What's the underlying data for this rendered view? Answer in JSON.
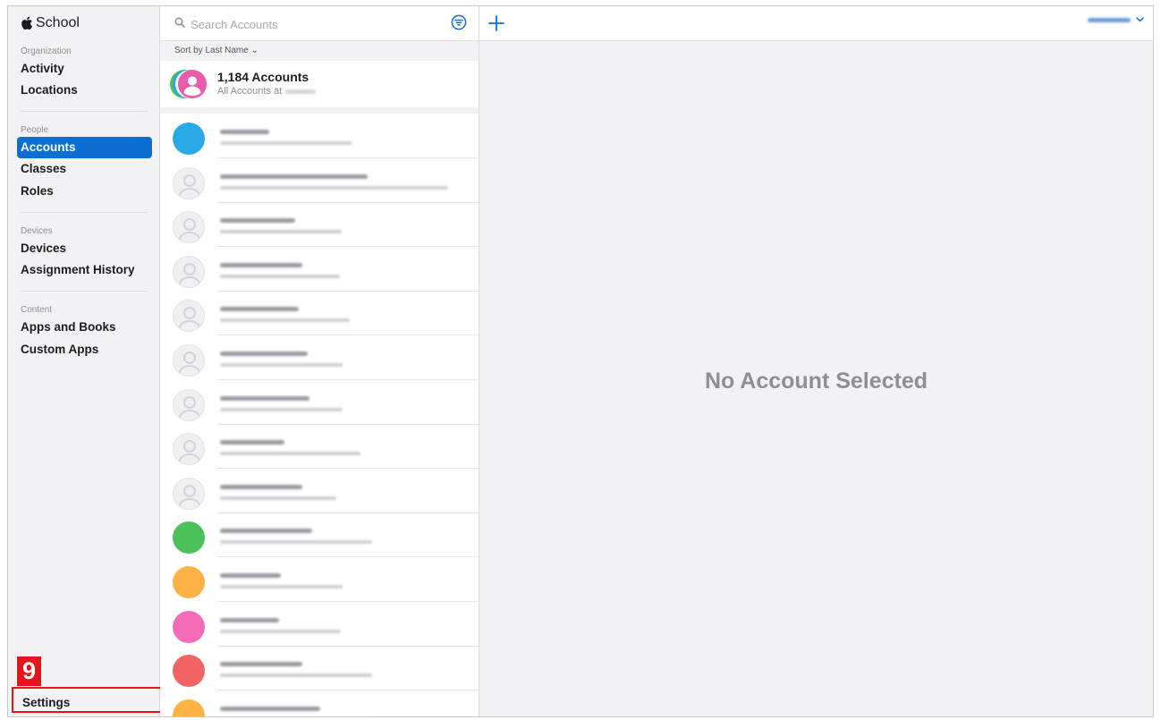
{
  "sidebar": {
    "brand": "School",
    "sections": {
      "organization": "Organization",
      "people": "People",
      "devices": "Devices",
      "content": "Content"
    },
    "items": {
      "activity": "Activity",
      "locations": "Locations",
      "accounts": "Accounts",
      "classes": "Classes",
      "roles": "Roles",
      "devices": "Devices",
      "assignment_history": "Assignment History",
      "apps_and_books": "Apps and Books",
      "custom_apps": "Custom Apps"
    },
    "settings": "Settings",
    "marker": "9",
    "active_item": "Accounts"
  },
  "list": {
    "search_placeholder": "Search Accounts",
    "sort_label": "Sort by Last Name ⌄",
    "summary_count": "1,184 Accounts",
    "summary_sub": "All Accounts at",
    "rows": [
      {
        "avatar": "color",
        "color": "#29aae4"
      },
      {
        "avatar": "placeholder"
      },
      {
        "avatar": "placeholder"
      },
      {
        "avatar": "placeholder"
      },
      {
        "avatar": "placeholder"
      },
      {
        "avatar": "placeholder"
      },
      {
        "avatar": "placeholder"
      },
      {
        "avatar": "placeholder"
      },
      {
        "avatar": "placeholder"
      },
      {
        "avatar": "color",
        "color": "#4cc15a"
      },
      {
        "avatar": "color",
        "color": "#ffb347"
      },
      {
        "avatar": "color",
        "color": "#f46bb7"
      },
      {
        "avatar": "color",
        "color": "#f26363"
      },
      {
        "avatar": "color",
        "color": "#ffb347"
      }
    ]
  },
  "detail": {
    "empty_state": "No Account Selected"
  },
  "colors": {
    "accent": "#0a6fd1",
    "highlight": "#e8141b"
  }
}
